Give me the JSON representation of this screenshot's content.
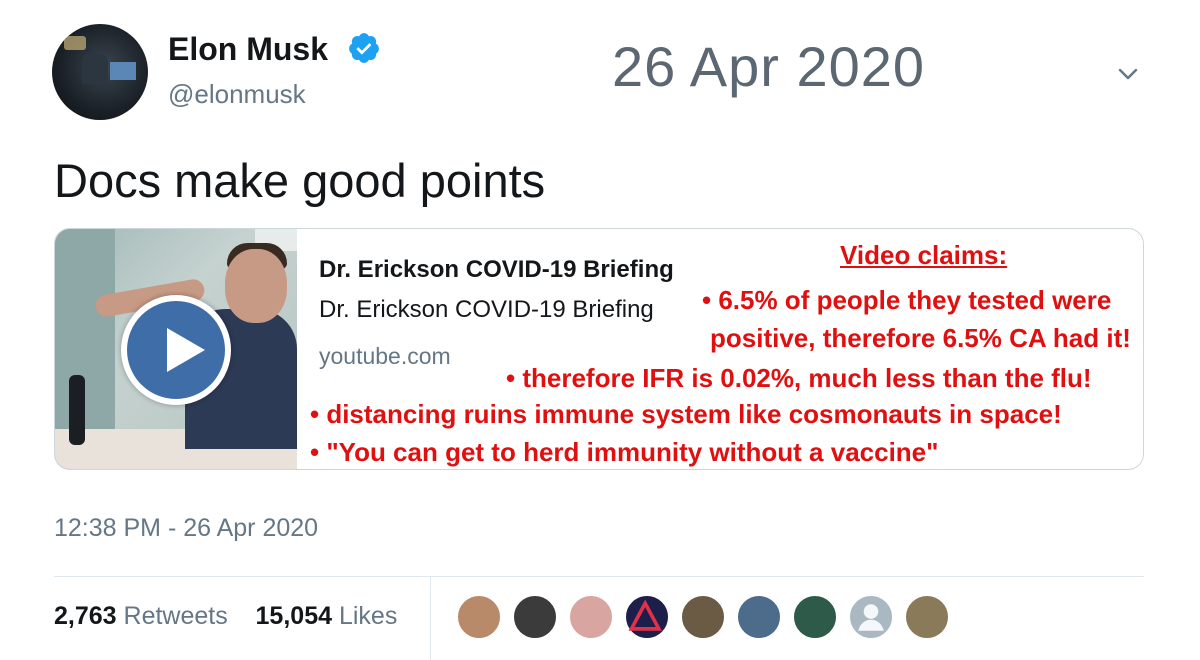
{
  "author": {
    "name": "Elon Musk",
    "handle": "@elonmusk",
    "verified": true
  },
  "overlay_date": "26 Apr 2020",
  "tweet_text": "Docs make good points",
  "card": {
    "title": "Dr. Erickson COVID-19 Briefing",
    "description": "Dr. Erickson COVID-19 Briefing",
    "domain": "youtube.com"
  },
  "annotations": {
    "title": "Video claims:",
    "items": [
      "• 6.5% of people they tested were",
      "positive, therefore 6.5% CA had it!",
      "• therefore IFR is 0.02%, much less than the flu!",
      "• distancing ruins immune system like cosmonauts in space!",
      "• \"You can get to herd immunity without a vaccine\""
    ],
    "color": "#e01010"
  },
  "timestamp": "12:38 PM - 26 Apr 2020",
  "stats": {
    "retweets_count": "2,763",
    "retweets_label": "Retweets",
    "likes_count": "15,054",
    "likes_label": "Likes"
  },
  "likers": [
    {
      "icon": "avatar-photo",
      "color": "#b88a6a"
    },
    {
      "icon": "avatar-photo",
      "color": "#3b3b3b"
    },
    {
      "icon": "avatar-photo",
      "color": "#d9a5a0"
    },
    {
      "icon": "avatar-logo",
      "color": "#1b1f4a"
    },
    {
      "icon": "avatar-photo",
      "color": "#6b5a44"
    },
    {
      "icon": "avatar-photo",
      "color": "#4d6b8a"
    },
    {
      "icon": "avatar-photo",
      "color": "#2e5a4a"
    },
    {
      "icon": "avatar-default",
      "color": "#aab8c2"
    },
    {
      "icon": "avatar-photo",
      "color": "#8a7a5a"
    }
  ],
  "colors": {
    "text": "#14171a",
    "secondary": "#657786",
    "verified": "#1da1f2",
    "border": "#ccd6dd"
  }
}
